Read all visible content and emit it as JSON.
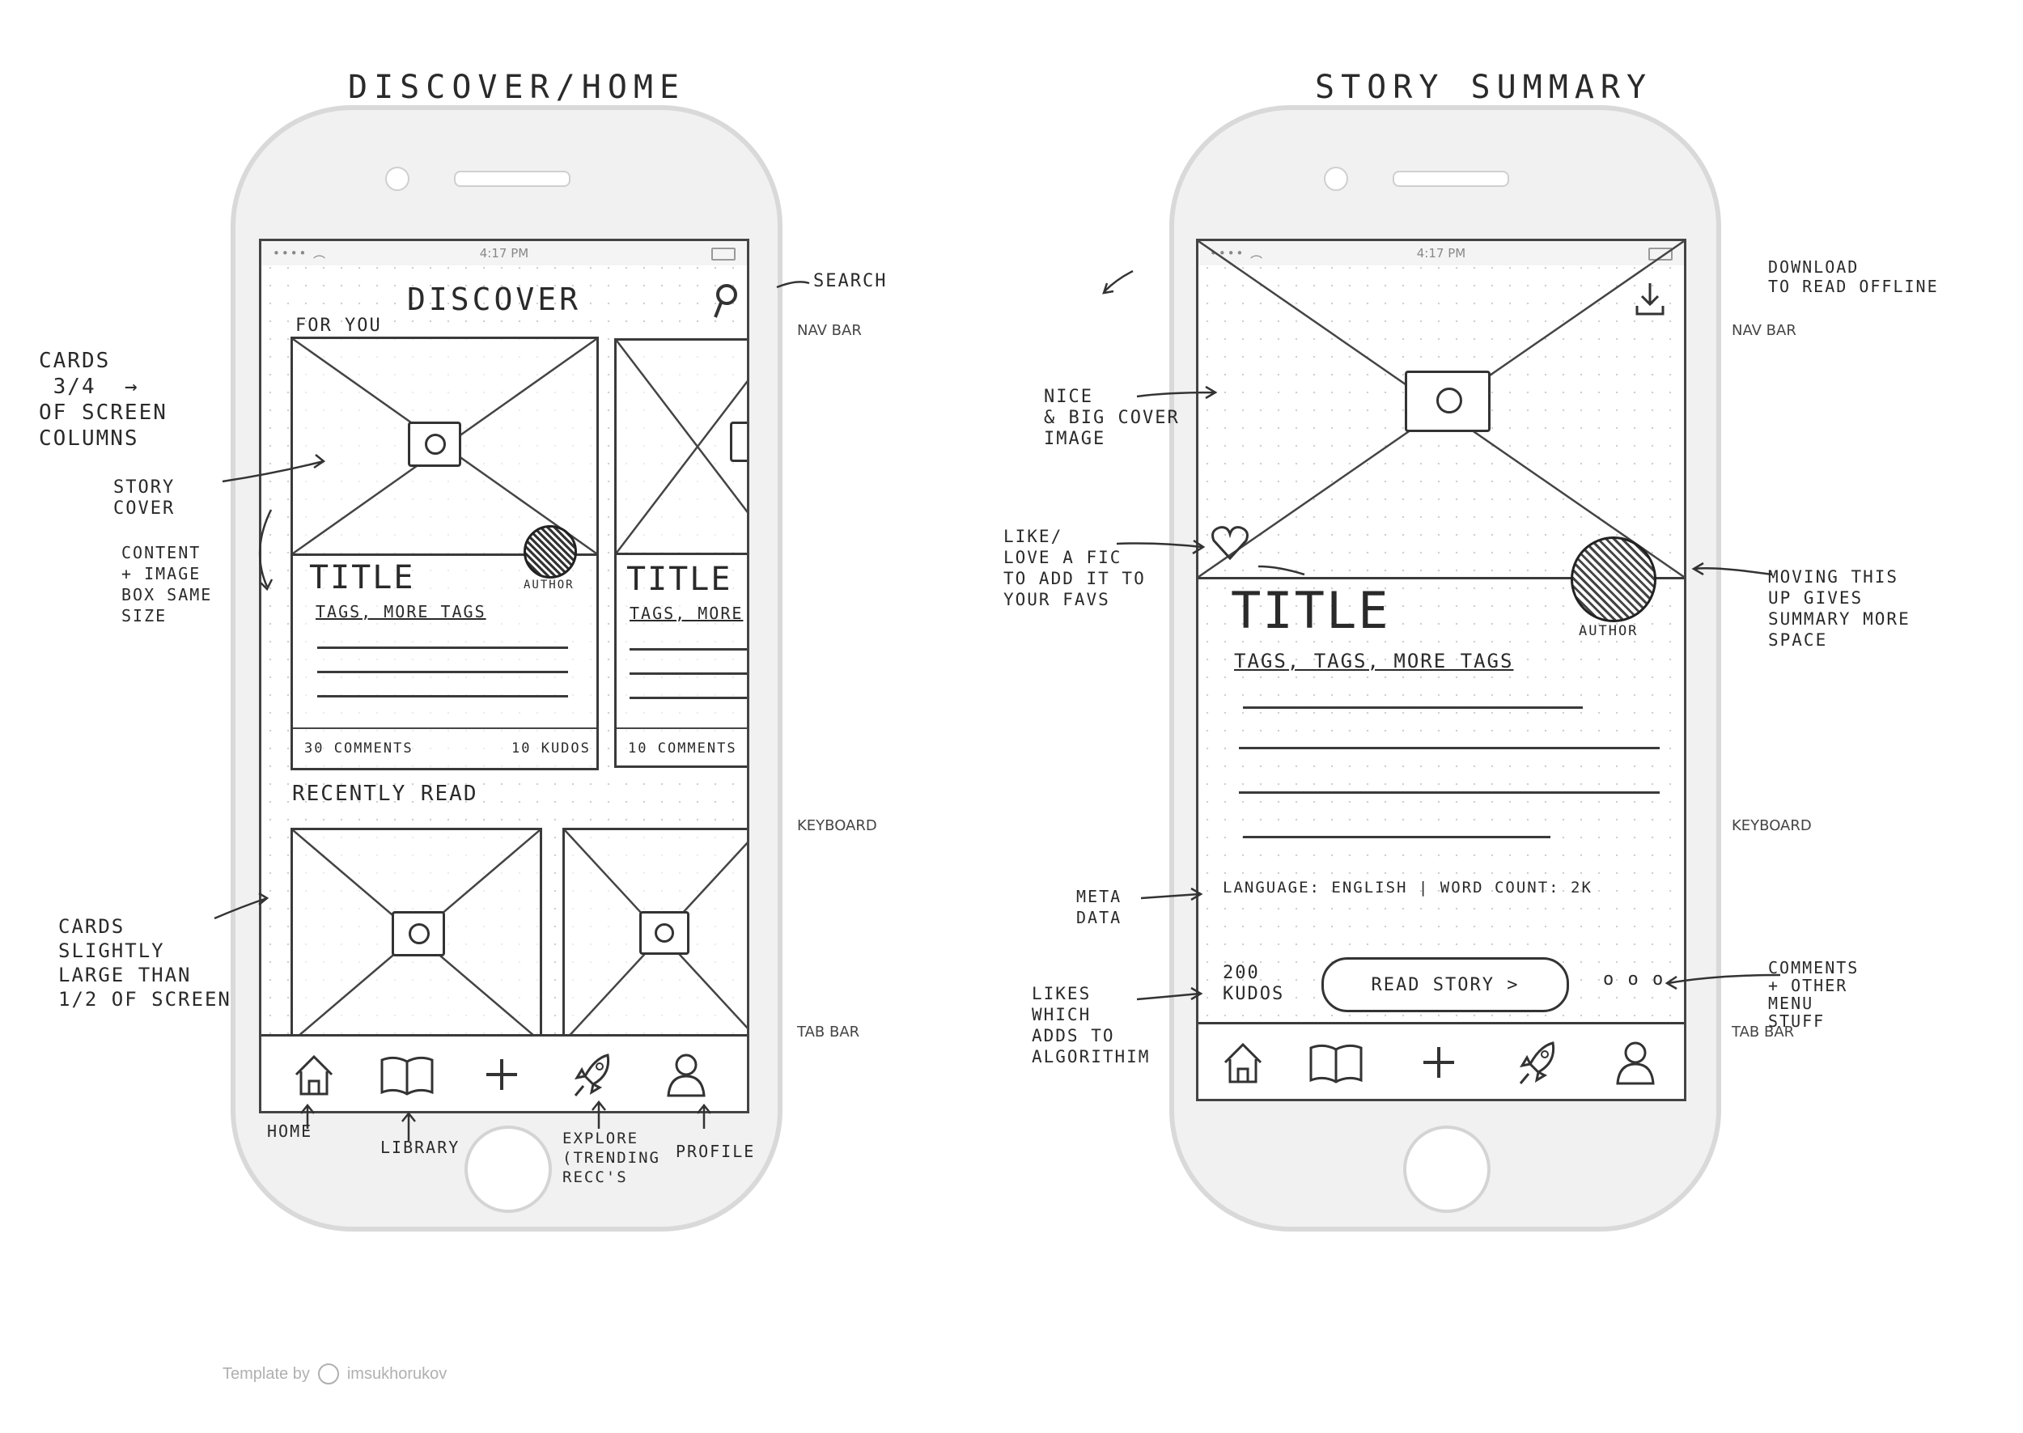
{
  "left": {
    "sheet_title": "DISCOVER/HOME",
    "status_time": "4:17 PM",
    "screen_title": "DISCOVER",
    "for_you_label": "FOR YOU",
    "card1": {
      "title": "TITLE",
      "tags": "TAGS, MORE TAGS",
      "author": "AUTHOR",
      "comments": "30 COMMENTS",
      "kudos": "10 KUDOS"
    },
    "card2": {
      "title": "TITLE",
      "tags": "TAGS, MORE",
      "comments": "10 COMMENTS"
    },
    "recently_read_label": "RECENTLY READ",
    "tabs": [
      {
        "icon": "home-icon",
        "glyph": "⌂"
      },
      {
        "icon": "library-icon",
        "glyph": "📖"
      },
      {
        "icon": "add-icon",
        "glyph": "+"
      },
      {
        "icon": "rocket-icon",
        "glyph": "🚀"
      },
      {
        "icon": "profile-icon",
        "glyph": "👤"
      }
    ],
    "annotations": {
      "search": "SEARCH",
      "nav_bar": "NAV BAR",
      "keyboard": "KEYBOARD",
      "tab_bar": "TAB BAR",
      "cards_34": "CARDS\n 3/4  →\nOF SCREEN\nCOLUMNS",
      "story_cover": "STORY\nCOVER",
      "content_image": "CONTENT\n+ IMAGE\nBOX SAME\nSIZE",
      "cards_half": "CARDS\nSLIGHTLY\nLARGE THAN\n1/2 OF SCREEN",
      "home": "HOME",
      "library": "LIBRARY",
      "explore": "EXPLORE\n(TRENDING\nRECC'S",
      "profile": "PROFILE"
    }
  },
  "right": {
    "sheet_title": "STORY SUMMARY",
    "status_time": "4:17 PM",
    "title": "TITLE",
    "tags": "TAGS, TAGS, MORE TAGS",
    "author": "AUTHOR",
    "meta": "LANGUAGE: ENGLISH | WORD COUNT: 2K",
    "kudos": "200\nKUDOS",
    "read_button": "READ STORY  >",
    "more_dots": "o o o",
    "annotations": {
      "download": "DOWNLOAD\nTO READ OFFLINE",
      "nav_bar": "NAV BAR",
      "big_cover": "NICE\n& BIG COVER\nIMAGE",
      "like": "LIKE/\nLOVE A FIC\nTO ADD IT TO\nYOUR FAVS",
      "moving": "MOVING THIS\nUP GIVES\nSUMMARY MORE\nSPACE",
      "meta_data": "META\nDATA",
      "likes": "LIKES\nWHICH\nADDS TO\nALGORITHIM",
      "comments": "COMMENTS\n+ OTHER\nMENU\nSTUFF",
      "keyboard": "KEYBOARD",
      "tab_bar": "TAB BAR"
    }
  },
  "footer": {
    "template_by": "Template by",
    "author": "imsukhorukov"
  }
}
